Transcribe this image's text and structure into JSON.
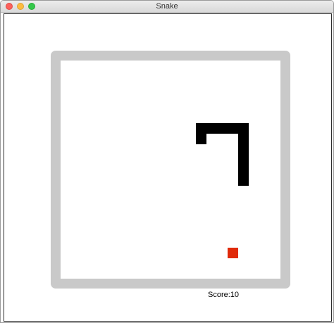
{
  "window": {
    "title": "Snake"
  },
  "game": {
    "score_text": "Score:10",
    "colors": {
      "wall": "#c9c9c9",
      "snake": "#000000",
      "food": "#e02a0a",
      "background": "#ffffff"
    }
  }
}
